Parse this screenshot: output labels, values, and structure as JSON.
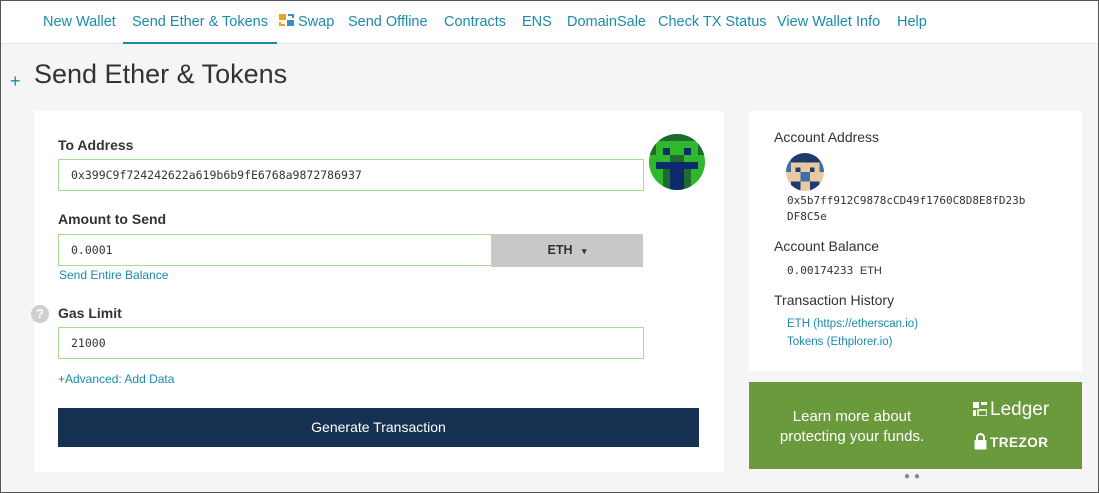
{
  "nav": {
    "items": [
      {
        "label": "New Wallet"
      },
      {
        "label": "Send Ether & Tokens"
      },
      {
        "label": "Swap"
      },
      {
        "label": "Send Offline"
      },
      {
        "label": "Contracts"
      },
      {
        "label": "ENS"
      },
      {
        "label": "DomainSale"
      },
      {
        "label": "Check TX Status"
      },
      {
        "label": "View Wallet Info"
      },
      {
        "label": "Help"
      }
    ],
    "active_index": 1
  },
  "page": {
    "plus": "+",
    "title": "Send Ether & Tokens"
  },
  "form": {
    "to_address_label": "To Address",
    "to_address_value": "0x399C9f724242622a619b6b9fE6768a9872786937",
    "amount_label": "Amount to Send",
    "amount_value": "0.0001",
    "currency": "ETH",
    "send_entire_balance": "Send Entire Balance",
    "gas_limit_label": "Gas Limit",
    "gas_limit_value": "21000",
    "help": "?",
    "advanced_link": "+Advanced: Add Data",
    "generate_button": "Generate Transaction"
  },
  "account": {
    "address_label": "Account Address",
    "address_line1": "0x5b7ff912C9878cCD49f1760C8D8E8fD23b",
    "address_line2": "DF8C5e",
    "balance_label": "Account Balance",
    "balance_value": "0.00174233",
    "balance_unit": "ETH",
    "history_label": "Transaction History",
    "history_eth": "ETH (https://etherscan.io)",
    "history_tokens": "Tokens (Ethplorer.io)"
  },
  "promo": {
    "text": "Learn more about protecting your funds.",
    "ledger": "Ledger",
    "trezor": "TREZOR",
    "bg_color": "#6a9a3b"
  },
  "colors": {
    "accent": "#1b8aad",
    "button": "#163151",
    "valid_border": "#a6dc93"
  }
}
